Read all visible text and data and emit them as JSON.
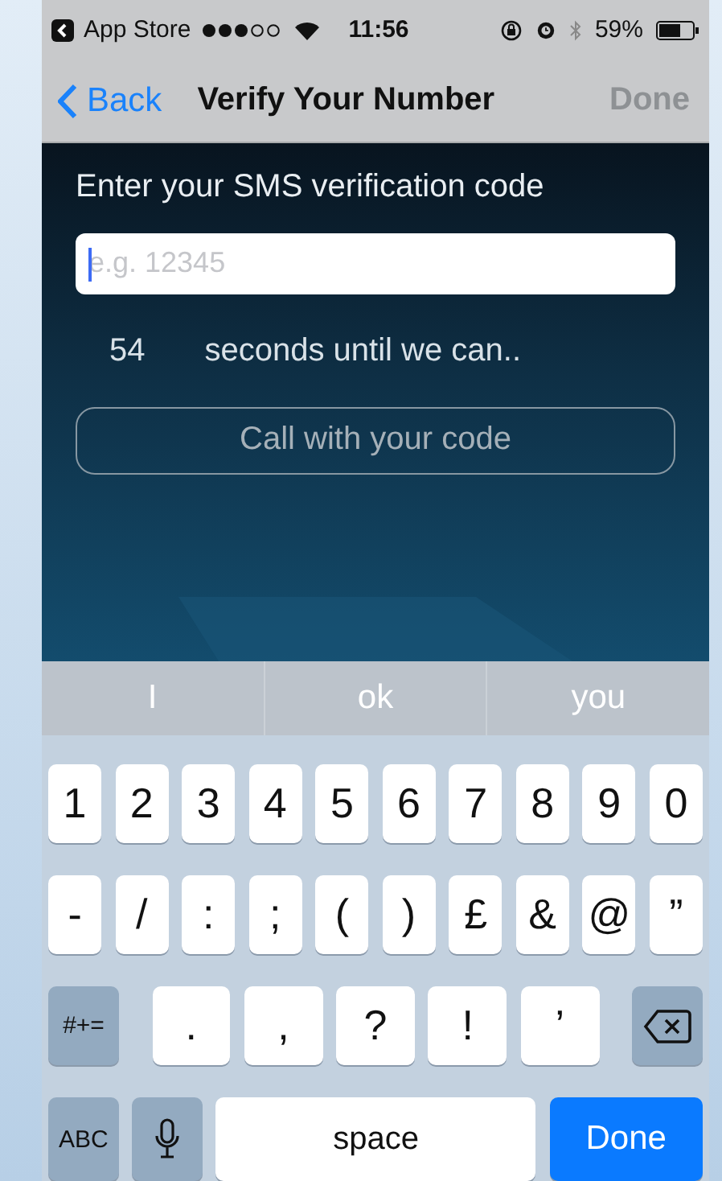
{
  "status_bar": {
    "back_app": "App Store",
    "time": "11:56",
    "battery": "59%"
  },
  "nav": {
    "back": "Back",
    "title": "Verify Your Number",
    "done": {
      "label": "Done",
      "disabled": true
    }
  },
  "content": {
    "prompt": "Enter your SMS verification code",
    "code_field": {
      "placeholder": "e.g. 12345"
    },
    "countdown": "54",
    "countdown_text": "seconds until we can..",
    "call_button": {
      "label": "Call with your code",
      "disabled": true
    }
  },
  "suggestions": [
    "I",
    "ok",
    "you"
  ],
  "keyboard": {
    "rows": [
      {
        "keys": [
          {
            "label": "1",
            "kind": "char"
          },
          {
            "label": "2",
            "kind": "char"
          },
          {
            "label": "3",
            "kind": "char"
          },
          {
            "label": "4",
            "kind": "char"
          },
          {
            "label": "5",
            "kind": "char"
          },
          {
            "label": "6",
            "kind": "char"
          },
          {
            "label": "7",
            "kind": "char"
          },
          {
            "label": "8",
            "kind": "char"
          },
          {
            "label": "9",
            "kind": "char"
          },
          {
            "label": "0",
            "kind": "char"
          }
        ]
      },
      {
        "keys": [
          {
            "label": "-",
            "kind": "char"
          },
          {
            "label": "/",
            "kind": "char"
          },
          {
            "label": ":",
            "kind": "char"
          },
          {
            "label": ";",
            "kind": "char"
          },
          {
            "label": "(",
            "kind": "char"
          },
          {
            "label": ")",
            "kind": "char"
          },
          {
            "label": "£",
            "kind": "char"
          },
          {
            "label": "&",
            "kind": "char"
          },
          {
            "label": "@",
            "kind": "char"
          },
          {
            "label": "”",
            "kind": "char"
          }
        ]
      },
      {
        "keys": [
          {
            "label": "#+=",
            "kind": "function"
          },
          {
            "label": ".",
            "kind": "wide"
          },
          {
            "label": ",",
            "kind": "wide"
          },
          {
            "label": "?",
            "kind": "wide"
          },
          {
            "label": "!",
            "kind": "wide"
          },
          {
            "label": "’",
            "kind": "wide"
          },
          {
            "kind": "backspace"
          }
        ]
      },
      {
        "keys": [
          {
            "label": "ABC",
            "kind": "function"
          },
          {
            "kind": "mic"
          },
          {
            "label": "space",
            "kind": "space"
          },
          {
            "label": "Done",
            "kind": "return"
          }
        ]
      }
    ]
  }
}
